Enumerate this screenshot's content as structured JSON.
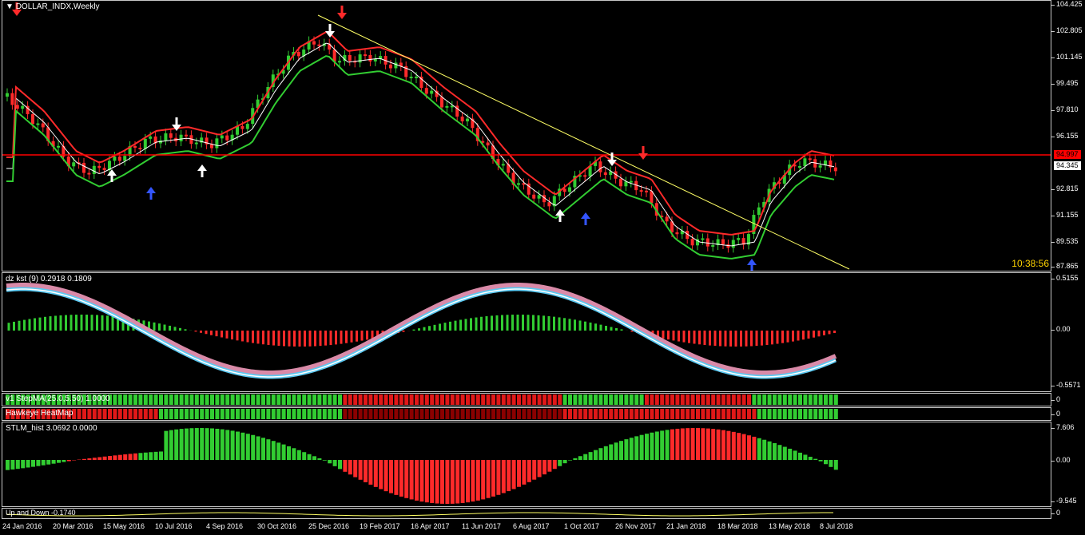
{
  "window": {
    "title": "DOLLAR_INDX,Weekly",
    "clock": "10:38:56"
  },
  "price": {
    "levels": [
      "104.425",
      "102.805",
      "101.145",
      "99.495",
      "97.810",
      "96.155",
      "94.345",
      "92.815",
      "91.155",
      "89.535",
      "87.865"
    ],
    "current_price": "94.345",
    "hline_price": "94.997"
  },
  "indicators": {
    "kst": {
      "title": "dz kst (9) 0.2918 0.1809",
      "levels": [
        "0.5155",
        "0.00",
        "-0.5571"
      ]
    },
    "stepma": {
      "title": "v1 StepMA(25.0,5.50) 1.0000",
      "value": "0"
    },
    "heatmap": {
      "title": "Hawkeye HeatMap",
      "value": "0"
    },
    "stlm": {
      "title": "STLM_hist 3.0692 0.0000",
      "levels": [
        "7.606",
        "0.00",
        "-9.545"
      ]
    },
    "updown": {
      "title": "Up and Down -0.1740",
      "value": "0"
    }
  },
  "dates": [
    "24 Jan 2016",
    "20 Mar 2016",
    "15 May 2016",
    "10 Jul 2016",
    "4 Sep 2016",
    "30 Oct 2016",
    "25 Dec 2016",
    "19 Feb 2017",
    "16 Apr 2017",
    "11 Jun 2017",
    "6 Aug 2017",
    "1 Oct 2017",
    "26 Nov 2017",
    "21 Jan 2018",
    "18 Mar 2018",
    "13 May 2018",
    "8 Jul 2018"
  ],
  "colors": {
    "up": "#32cd32",
    "down": "#ff2a2a",
    "trend": "#ffff66",
    "hline": "#ff0000",
    "sky": "#5bc8f0",
    "pink": "#d98aa8"
  }
}
